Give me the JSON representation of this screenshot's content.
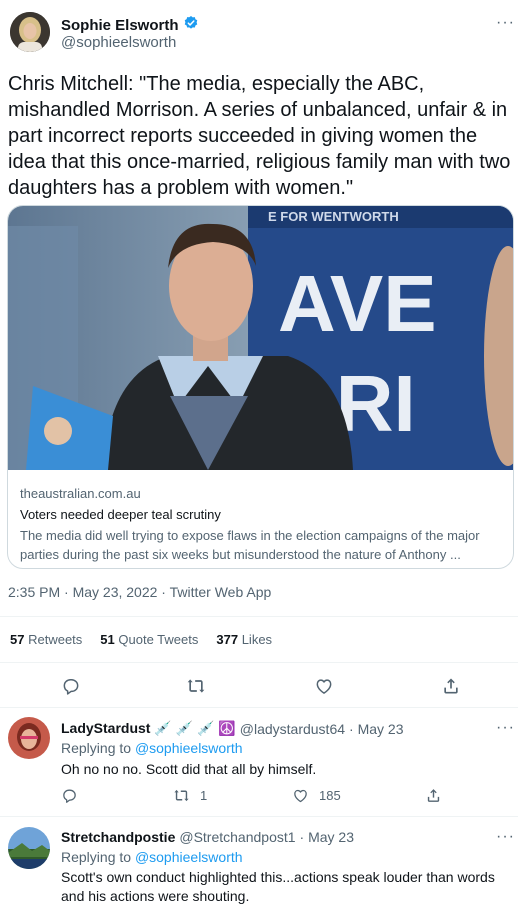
{
  "main_tweet": {
    "author_name": "Sophie Elsworth",
    "author_handle": "@sophieelsworth",
    "more_label": "···",
    "text": "Chris Mitchell: \"The media, especially the ABC, mishandled Morrison. A series of unbalanced, unfair & in part incorrect reports succeeded in giving women the idea that this once-married, religious family man with two daughters has a problem with women.\"",
    "link_card": {
      "domain": "theaustralian.com.au",
      "title": "Voters needed deeper teal scrutiny",
      "description": "The media did well trying to expose flaws in the election campaigns of the major parties during the past six weeks but misunderstood the nature of Anthony ...",
      "image_sign_text": "AVE",
      "image_sign_text2": "ARI",
      "image_banner_text": "E FOR WENTWORTH"
    },
    "timestamp": "2:35 PM · May 23, 2022 · Twitter Web App",
    "stats": {
      "retweets_count": "57",
      "retweets_label": "Retweets",
      "quotes_count": "51",
      "quotes_label": "Quote Tweets",
      "likes_count": "377",
      "likes_label": "Likes"
    }
  },
  "replies": [
    {
      "author_name": "LadyStardust 💉 💉 💉 ☮️",
      "author_handle": "@ladystardust64",
      "date": "· May 23",
      "replying_prefix": "Replying to",
      "replying_to": "@sophieelsworth",
      "text": "Oh no no no. Scott did that all by himself.",
      "retweets": "1",
      "likes": "185"
    },
    {
      "author_name": "Stretchandpostie",
      "author_handle": "@Stretchandpost1",
      "date": "· May 23",
      "replying_prefix": "Replying to",
      "replying_to": "@sophieelsworth",
      "text": "Scott's own conduct highlighted this...actions speak louder than words and his actions were shouting."
    }
  ],
  "colors": {
    "accent": "#1d9bf0",
    "text": "#0f1419",
    "secondary": "#536471",
    "border": "#cfd9de"
  }
}
